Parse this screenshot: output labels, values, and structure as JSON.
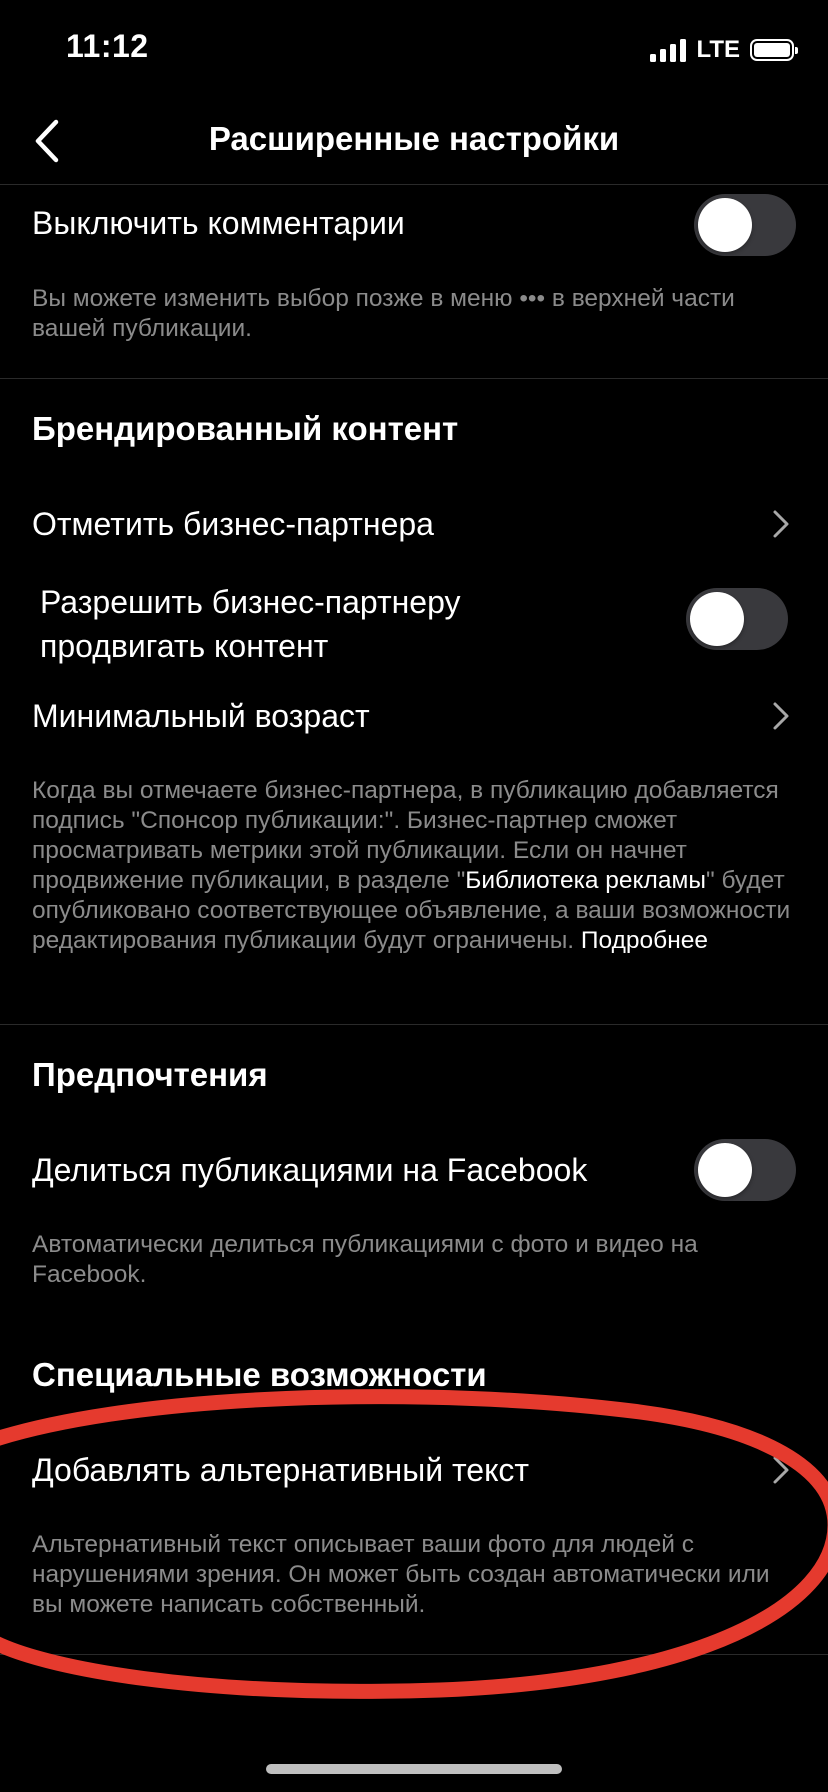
{
  "status_bar": {
    "time": "11:12",
    "network": "LTE"
  },
  "header": {
    "title": "Расширенные настройки"
  },
  "comments": {
    "label": "Выключить комментарии",
    "toggle_on": false,
    "description_pre": "Вы можете изменить выбор позже в меню ",
    "description_dots": "•••",
    "description_post": " в верхней части вашей публикации."
  },
  "branded": {
    "title": "Брендированный контент",
    "tag_partner": "Отметить бизнес-партнера",
    "allow_promote_line1": "Разрешить бизнес-партнеру",
    "allow_promote_line2": "продвигать контент",
    "allow_promote_on": false,
    "min_age": "Минимальный возраст",
    "desc_part1": "Когда вы отмечаете бизнес-партнера, в публикацию добавляется подпись \"Спонсор публикации:\". Бизнес-партнер сможет просматривать метрики этой публикации. Если он начнет продвижение публикации, в разделе \"",
    "desc_link1": "Библиотека рекламы",
    "desc_part2": "\" будет опубликовано соответствующее объявление, а ваши возможности редактирования публикации будут ограничены. ",
    "desc_link2": "Подробнее"
  },
  "preferences": {
    "title": "Предпочтения",
    "share_fb": "Делиться публикациями на Facebook",
    "share_fb_on": false,
    "share_fb_desc": "Автоматически делиться публикациями с фото и видео на Facebook."
  },
  "accessibility": {
    "title": "Специальные возможности",
    "alt_text": "Добавлять альтернативный текст",
    "alt_text_desc": "Альтернативный текст описывает ваши фото для людей с нарушениями зрения. Он может быть создан автоматически или вы можете написать собственный."
  },
  "colors": {
    "background": "#000000",
    "secondary_text": "#8b8b8b",
    "toggle_off": "#39393d",
    "annotation": "#e53a2e"
  }
}
